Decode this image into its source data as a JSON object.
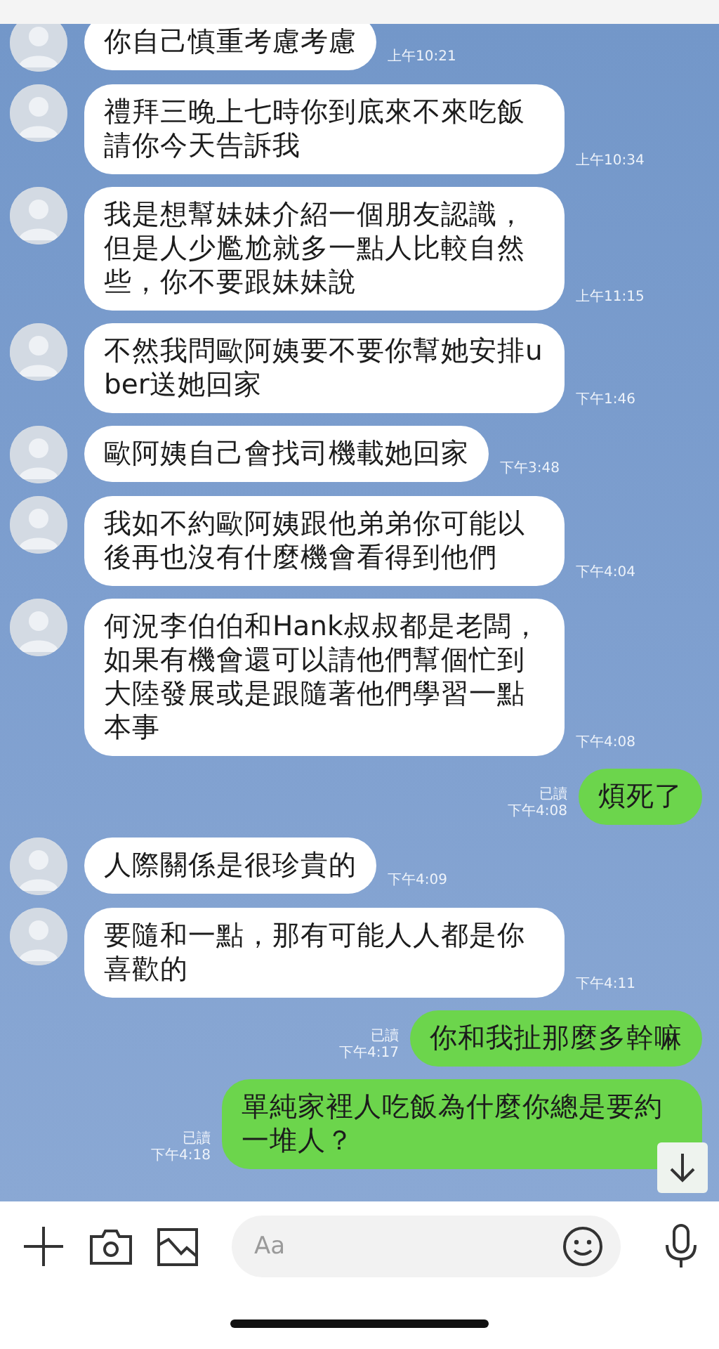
{
  "messages": [
    {
      "kind": "incoming",
      "text": "你自己慎重考慮考慮",
      "time": "上午10:21"
    },
    {
      "kind": "incoming",
      "text": "禮拜三晚上七時你到底來不來吃飯請你今天告訴我",
      "time": "上午10:34"
    },
    {
      "kind": "incoming",
      "text": "我是想幫妹妹介紹一個朋友認識，但是人少尷尬就多一點人比較自然些，你不要跟妹妹說",
      "time": "上午11:15"
    },
    {
      "kind": "incoming",
      "text": "不然我問歐阿姨要不要你幫她安排uber送她回家",
      "time": "下午1:46"
    },
    {
      "kind": "incoming",
      "text": "歐阿姨自己會找司機載她回家",
      "time": "下午3:48"
    },
    {
      "kind": "incoming",
      "text": "我如不約歐阿姨跟他弟弟你可能以後再也沒有什麼機會看得到他們",
      "time": "下午4:04"
    },
    {
      "kind": "incoming",
      "text": "何況李伯伯和Hank叔叔都是老闆，如果有機會還可以請他們幫個忙到大陸發展或是跟隨著他們學習一點本事",
      "time": "下午4:08"
    },
    {
      "kind": "outgoing",
      "text": "煩死了",
      "time": "下午4:08",
      "read_label": "已讀"
    },
    {
      "kind": "incoming",
      "text": "人際關係是很珍貴的",
      "time": "下午4:09"
    },
    {
      "kind": "incoming",
      "text": "要隨和一點，那有可能人人都是你喜歡的",
      "time": "下午4:11"
    },
    {
      "kind": "outgoing",
      "text": "你和我扯那麼多幹嘛",
      "time": "下午4:17",
      "read_label": "已讀"
    },
    {
      "kind": "outgoing",
      "text": "單純家裡人吃飯為什麼你總是要約一堆人？",
      "time": "下午4:18",
      "read_label": "已讀"
    }
  ],
  "input": {
    "placeholder": "Aa"
  }
}
